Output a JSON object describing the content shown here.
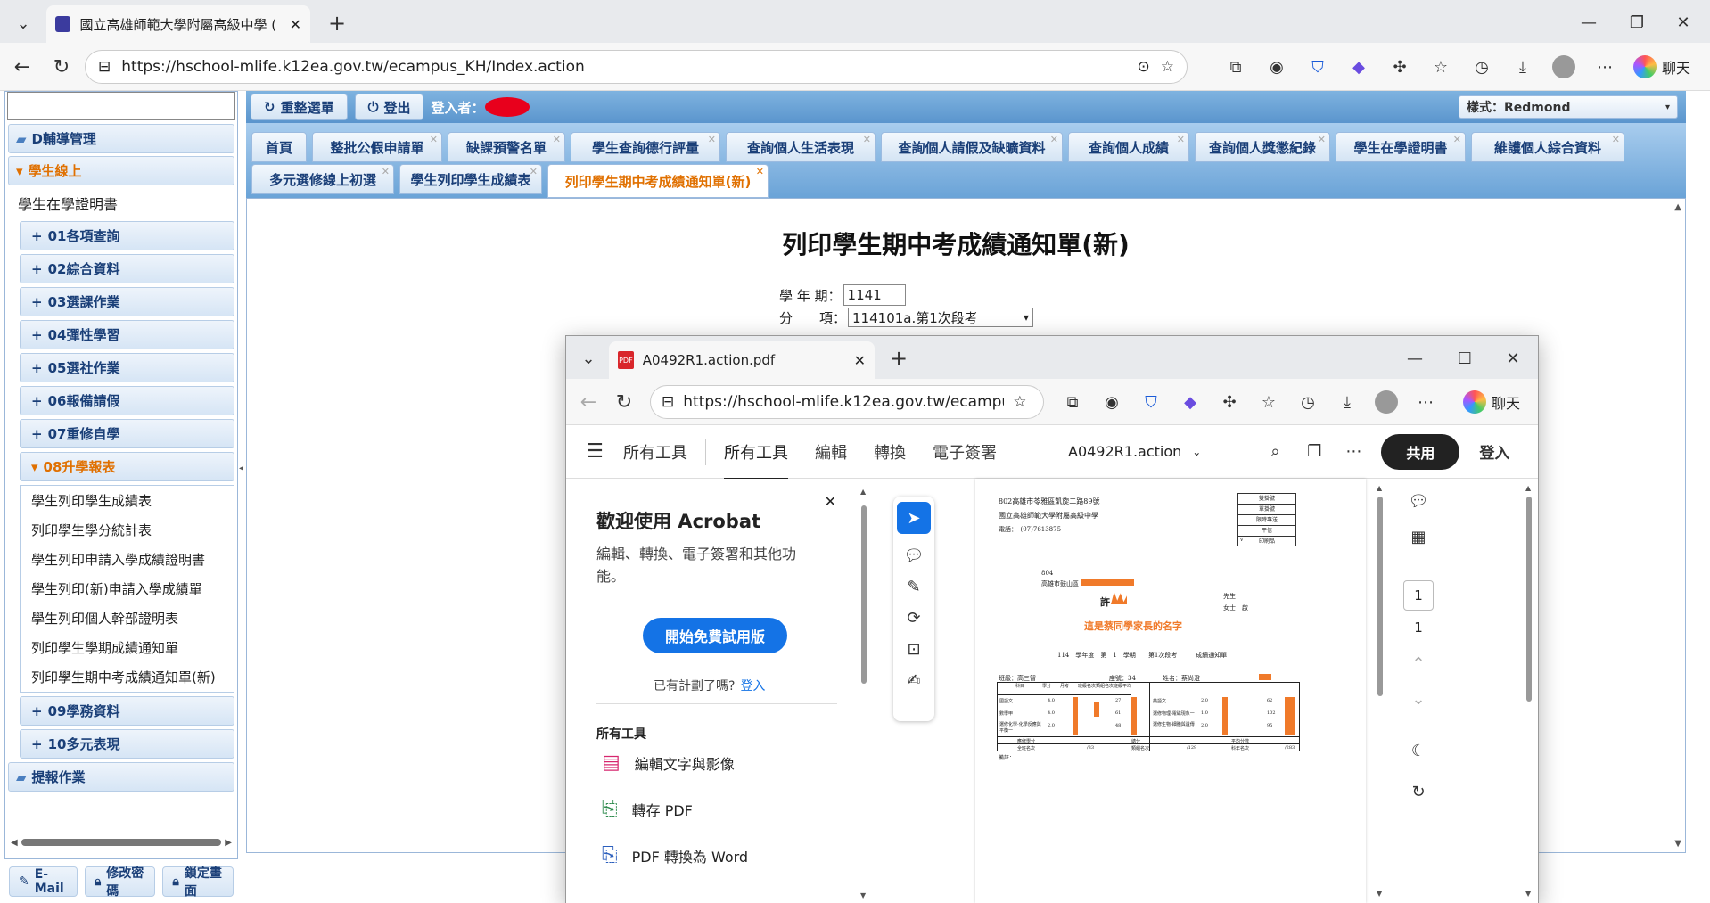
{
  "browser": {
    "tab_title": "國立高雄師範大學附屬高級中學 (",
    "url": "https://hschool-mlife.k12ea.gov.tw/ecampus_KH/Index.action",
    "chat_label": "聊天"
  },
  "toolbar": {
    "reset_menu": "重整選單",
    "logout": "登出",
    "login_label": "登入者：",
    "style_label": "樣式：Redmond"
  },
  "sidebar": {
    "search_value": "",
    "groups": [
      {
        "label": "D輔導管理"
      },
      {
        "label": "學生線上"
      }
    ],
    "top_item": "學生在學證明書",
    "subs": [
      "01各項查詢",
      "02綜合資料",
      "03選課作業",
      "04彈性學習",
      "05選社作業",
      "06報備請假",
      "07重修自學",
      "08升學報表"
    ],
    "links": [
      "學生列印學生成績表",
      "列印學生學分統計表",
      "學生列印申請入學成績證明書",
      "學生列印(新)申請入學成績單",
      "學生列印個人幹部證明表",
      "列印學生學期成績通知單",
      "列印學生期中考成績通知單(新)"
    ],
    "subs_after": [
      "09學務資料",
      "10多元表現"
    ],
    "last_group": "提報作業"
  },
  "bottom_buttons": {
    "email": "E-Mail",
    "password": "修改密碼",
    "lock": "鎖定畫面"
  },
  "tabs_row1": [
    "首頁",
    "整批公假申請單",
    "缺課預警名單",
    "學生查詢德行評量",
    "查詢個人生活表現",
    "查詢個人請假及缺曠資料",
    "查詢個人成績",
    "查詢個人獎懲紀錄",
    "學生在學證明書",
    "維護個人綜合資料"
  ],
  "tabs_row2": [
    "多元選修線上初選",
    "學生列印學生成績表",
    "列印學生期中考成績通知單(新)"
  ],
  "page": {
    "title": "列印學生期中考成績通知單(新)",
    "term_label": "學 年 期：",
    "term_value": "1141",
    "item_label": "分　　項：",
    "item_value": "114101a.第1次段考"
  },
  "popup": {
    "tab_title": "A0492R1.action.pdf",
    "url": "https://hschool-mlife.k12ea.gov.tw/ecampus...",
    "chat_label": "聊天",
    "menu_all_tools": "所有工具",
    "nav": [
      "所有工具",
      "編輯",
      "轉換",
      "電子簽署"
    ],
    "doc_name": "A0492R1.action",
    "share": "共用",
    "login": "登入",
    "welcome_title": "歡迎使用 Acrobat",
    "welcome_desc": "編輯、轉換、電子簽署和其他功能。",
    "trial_button": "開始免費試用版",
    "have_plan": "已有計劃了嗎?",
    "have_plan_link": "登入",
    "tools_heading": "所有工具",
    "tools": [
      "編輯文字與影像",
      "轉存 PDF",
      "PDF 轉換為 Word"
    ],
    "page_current": "1",
    "page_total": "1"
  },
  "pdf": {
    "addr1": "802高雄市苓雅區凱旋二路89號",
    "school": "國立高雄師範大學附屬高級中學",
    "phone": "電話：　(07)7613875",
    "post_code": "804",
    "recipient_addr": "高雄市鼓山區",
    "recipient_prefix": "許",
    "note": "這是蔡同學家長的名字",
    "salute1": "先生",
    "salute2": "女士　啟",
    "doc_title": "114　學年度　第　1　學期　　第1次段考　　　成績通知單",
    "class": "班級：高三智",
    "seat": "座號：34",
    "name": "姓名：蔡尚澄",
    "stamp_rows": [
      "雙掛號",
      "單掛號",
      "限時專送",
      "平信",
      "印刷品"
    ],
    "stamp_check": "v",
    "grade_headers": [
      "科目",
      "學分",
      "月考",
      "班級名次",
      "類組名次",
      "班級平均"
    ],
    "subjects_left": [
      "國語文",
      "數學甲",
      "選修化學-化學反應與平衡一"
    ],
    "credits_left": [
      "4.0",
      "4.0",
      "2.0"
    ],
    "scores_left": [
      "27",
      "61",
      "48"
    ],
    "subjects_right": [
      "英語文",
      "選修物理-電磁現象一",
      "選修生物-細胞與遺傳"
    ],
    "credits_right": [
      "2.0",
      "1.0",
      "2.0"
    ],
    "scores_right": [
      "62",
      "102",
      "95"
    ],
    "footer": [
      "應修學分",
      "總分",
      "平均分數"
    ],
    "rank_labels": [
      "全班名次",
      "類組名次",
      "科年名次"
    ],
    "rank_values": [
      "/33",
      "/129",
      "/283"
    ],
    "remark": "備註："
  }
}
